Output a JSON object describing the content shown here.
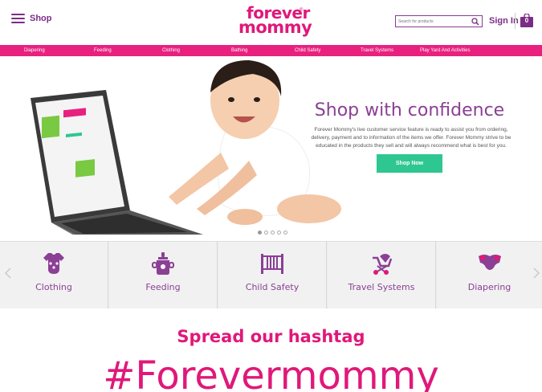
{
  "header": {
    "menu_label": "Shop",
    "logo_line1": "forever",
    "logo_line2": "mommy",
    "logo_mark": "®",
    "search_placeholder": "Search for products",
    "sign_in_label": "Sign In",
    "cart_count": "0"
  },
  "category_nav": [
    "Diapering",
    "Feeding",
    "Clothing",
    "Bathing",
    "Child Safety",
    "Travel Systems",
    "Play Yard And Activities"
  ],
  "hero": {
    "title": "Shop with confidence",
    "body": "Forever Mommy's live customer service feature is ready to assist you from ordering, delivery, payment and to information of the items we offer. Forever Mommy strive to be educated in the products they sell and will always recommend what is best for you.",
    "cta_label": "Shop Now",
    "slide_count": 5,
    "active_slide": 1
  },
  "tiles": [
    {
      "label": "Clothing",
      "icon": "onesie-icon"
    },
    {
      "label": "Feeding",
      "icon": "sippy-cup-icon"
    },
    {
      "label": "Child Safety",
      "icon": "crib-icon"
    },
    {
      "label": "Travel Systems",
      "icon": "stroller-icon"
    },
    {
      "label": "Diapering",
      "icon": "diaper-icon"
    }
  ],
  "hashtag_section": {
    "heading": "Spread our hashtag",
    "hashtag": "#Forevermommy"
  },
  "colors": {
    "brand_pink": "#e0187a",
    "nav_pink": "#e8217f",
    "brand_purple": "#8b3f95",
    "cta_green": "#2ec791"
  }
}
